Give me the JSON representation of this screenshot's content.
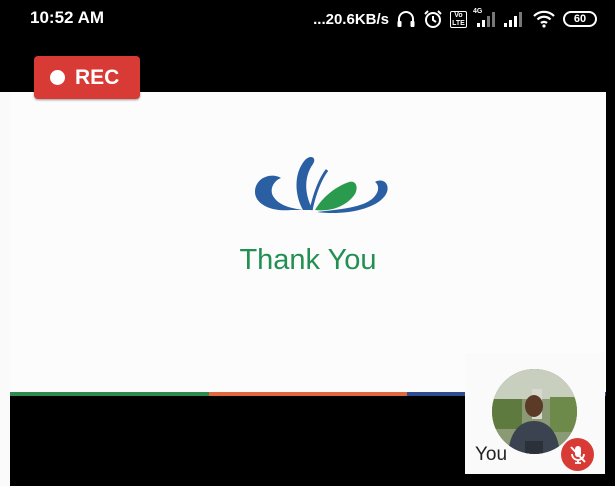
{
  "status_bar": {
    "time": "10:52 AM",
    "dots": "...",
    "speed": "20.6KB/s",
    "volte_label": "Vo LTE",
    "network_label": "4G",
    "battery_level": "60",
    "icons": [
      "headphones-icon",
      "alarm-icon",
      "volte-icon",
      "signal-4g-icon",
      "signal-icon",
      "wifi-icon",
      "battery-icon"
    ]
  },
  "recording": {
    "label": "REC",
    "color": "#d83a35"
  },
  "slide": {
    "text": "Thank You",
    "text_color": "#239053",
    "bar_colors": [
      "#2e8b4f",
      "#e0683e",
      "#2e4c8f"
    ]
  },
  "self_view": {
    "name": "You",
    "mic_state_icon": "mic-off-icon"
  }
}
